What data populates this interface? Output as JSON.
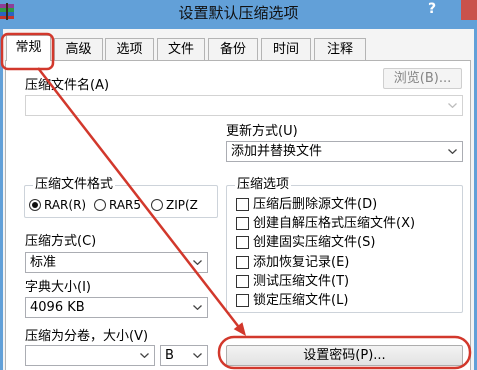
{
  "window": {
    "title": "设置默认压缩选项",
    "help_label": "?",
    "icon": "winrar-icon"
  },
  "colors": {
    "title_bar": "#62a0d8",
    "close_button": "#c9524b",
    "annotation": "#d2382c",
    "tab_page": "#ffffff"
  },
  "tabs": [
    {
      "label": "常规",
      "active": true
    },
    {
      "label": "高级",
      "active": false
    },
    {
      "label": "选项",
      "active": false
    },
    {
      "label": "文件",
      "active": false
    },
    {
      "label": "备份",
      "active": false
    },
    {
      "label": "时间",
      "active": false
    },
    {
      "label": "注释",
      "active": false
    }
  ],
  "general": {
    "archive_name": {
      "label": "压缩文件名(A)",
      "value": "",
      "browse_label": "浏览(B)...",
      "disabled": true
    },
    "update_mode": {
      "label": "更新方式(U)",
      "value": "添加并替换文件"
    },
    "archive_format": {
      "title": "压缩文件格式",
      "options": [
        {
          "label": "RAR(R)",
          "selected": true
        },
        {
          "label": "RAR5",
          "selected": false
        },
        {
          "label": "ZIP(Z",
          "selected": false
        }
      ]
    },
    "archive_options": {
      "title": "压缩选项",
      "items": [
        {
          "label": "压缩后删除源文件(D)",
          "checked": false
        },
        {
          "label": "创建自解压格式压缩文件(X)",
          "checked": false
        },
        {
          "label": "创建固实压缩文件(S)",
          "checked": false
        },
        {
          "label": "添加恢复记录(E)",
          "checked": false
        },
        {
          "label": "测试压缩文件(T)",
          "checked": false
        },
        {
          "label": "锁定压缩文件(L)",
          "checked": false
        }
      ]
    },
    "compression_method": {
      "label": "压缩方式(C)",
      "value": "标准"
    },
    "dictionary_size": {
      "label": "字典大小(I)",
      "value": "4096 KB"
    },
    "split_volumes": {
      "label": "压缩为分卷，大小(V)",
      "value": "",
      "unit": "B"
    },
    "set_password_label": "设置密码(P)..."
  }
}
